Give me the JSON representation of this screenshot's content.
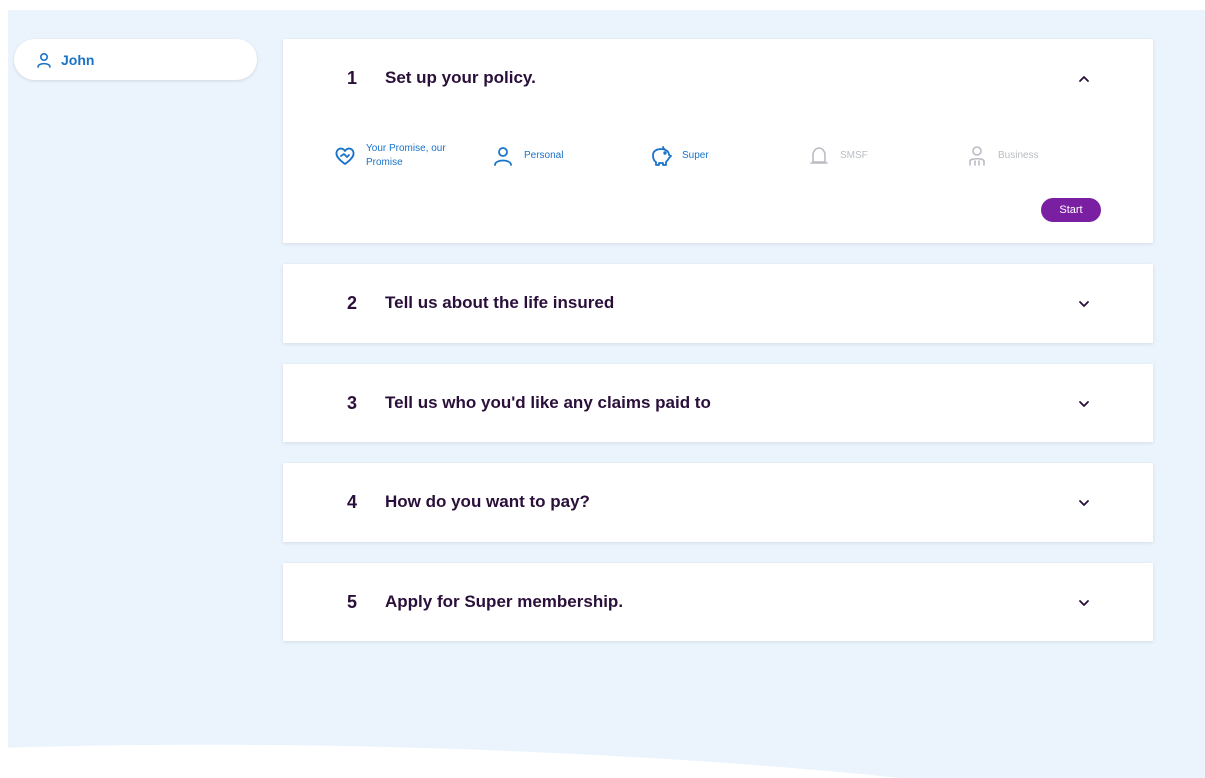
{
  "user": {
    "name": "John",
    "icon": "user-icon"
  },
  "colors": {
    "accent": "#1a73c8",
    "primary_button": "#7b1fa2",
    "title_text": "#2a0f3a",
    "disabled": "#b8bcc3",
    "background": "#ebf4fd"
  },
  "steps": [
    {
      "number": "1",
      "title": "Set up your policy.",
      "expanded": true,
      "chevron": "chevron-up-icon",
      "options": [
        {
          "label": "Your Promise, our Promise",
          "icon": "heart-handshake-icon",
          "enabled": true
        },
        {
          "label": "Personal",
          "icon": "person-icon",
          "enabled": true
        },
        {
          "label": "Super",
          "icon": "piggy-bank-icon",
          "enabled": true
        },
        {
          "label": "SMSF",
          "icon": "bell-icon",
          "enabled": false
        },
        {
          "label": "Business",
          "icon": "people-icon",
          "enabled": false
        }
      ],
      "start_label": "Start"
    },
    {
      "number": "2",
      "title": "Tell us about the life insured",
      "expanded": false,
      "chevron": "chevron-down-icon"
    },
    {
      "number": "3",
      "title": "Tell us who you'd like any claims paid to",
      "expanded": false,
      "chevron": "chevron-down-icon"
    },
    {
      "number": "4",
      "title": "How do you want to pay?",
      "expanded": false,
      "chevron": "chevron-down-icon"
    },
    {
      "number": "5",
      "title": "Apply for Super membership.",
      "expanded": false,
      "chevron": "chevron-down-icon"
    }
  ]
}
